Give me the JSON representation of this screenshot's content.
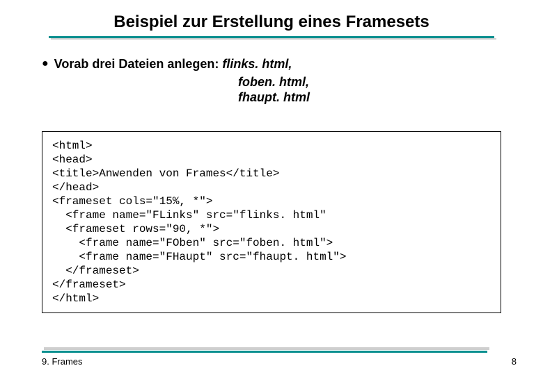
{
  "title": "Beispiel zur Erstellung eines Framesets",
  "bullet": {
    "prefix": "Vorab drei Dateien anlegen: ",
    "file1": "flinks. html,",
    "file2": "foben. html,",
    "file3": "fhaupt. html"
  },
  "code": {
    "lines": [
      "<html>",
      "<head>",
      "<title>Anwenden von Frames</title>",
      "</head>",
      "<frameset cols=\"15%, *\">",
      "  <frame name=\"FLinks\" src=\"flinks. html\"",
      "  <frameset rows=\"90, *\">",
      "    <frame name=\"FOben\" src=\"foben. html\">",
      "    <frame name=\"FHaupt\" src=\"fhaupt. html\">",
      "  </frameset>",
      "</frameset>",
      "</html>"
    ]
  },
  "footer": {
    "left": "9. Frames",
    "right": "8"
  }
}
